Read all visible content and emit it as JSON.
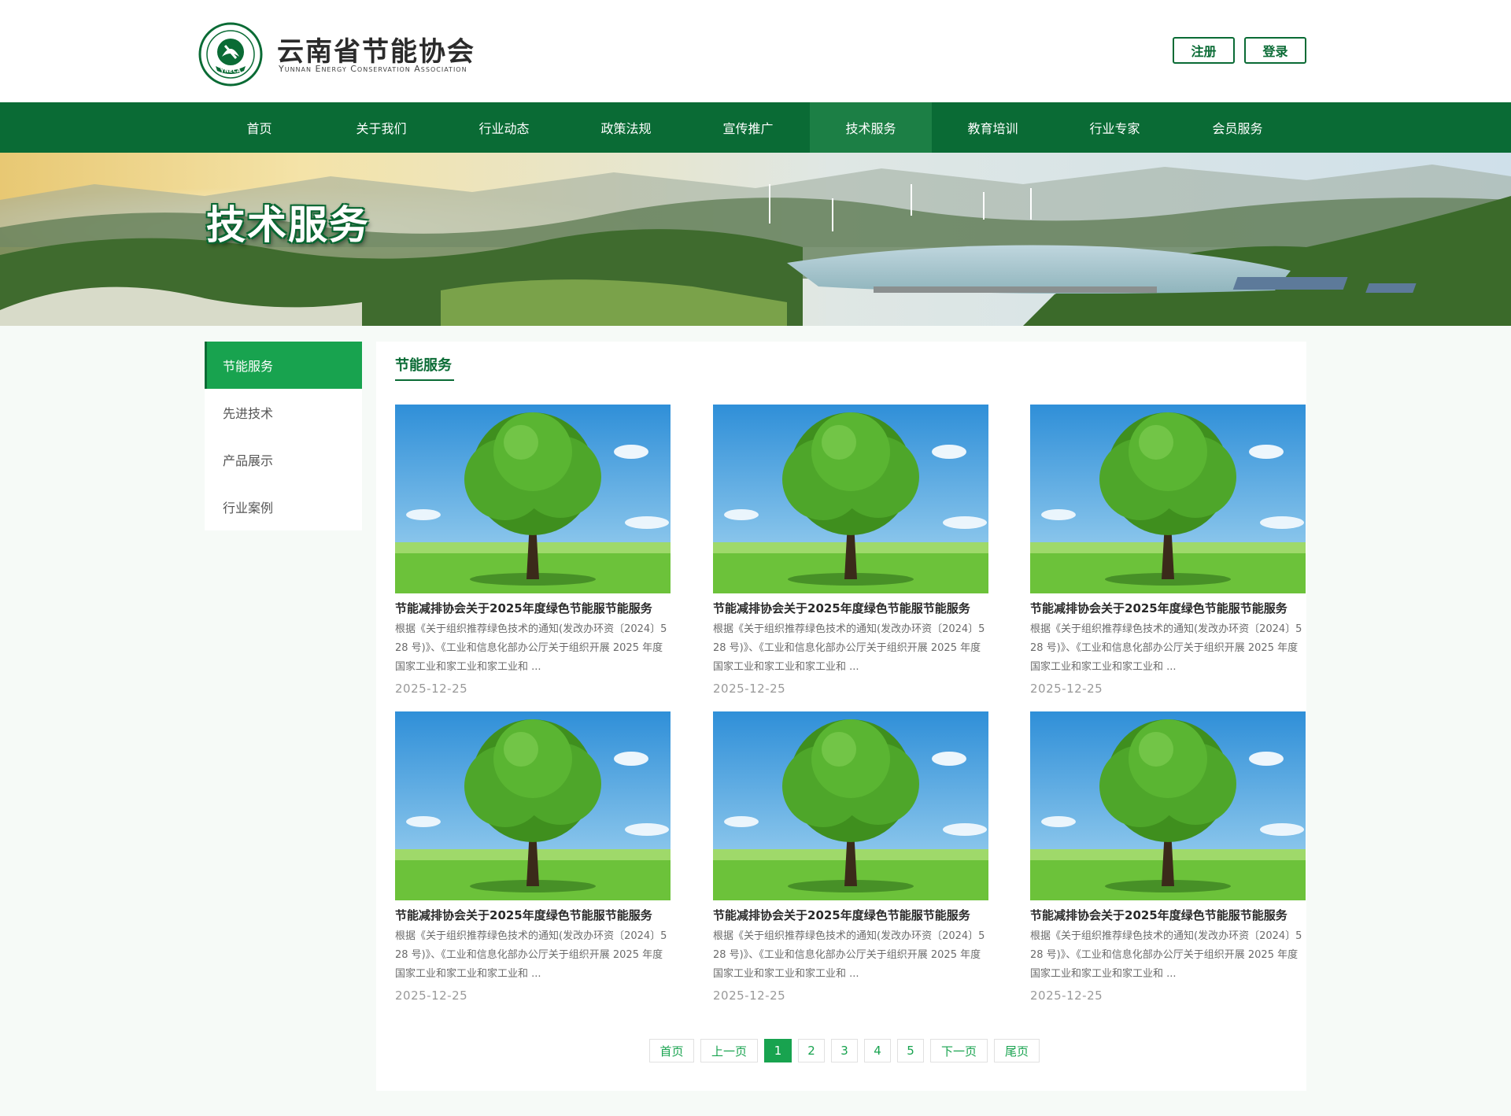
{
  "header": {
    "title": "云南省节能协会",
    "subtitle": "Yunnan Energy Conservation Association",
    "logo_text": "YNECA",
    "register_label": "注册",
    "login_label": "登录"
  },
  "nav": {
    "items": [
      {
        "label": "首页"
      },
      {
        "label": "关于我们"
      },
      {
        "label": "行业动态"
      },
      {
        "label": "政策法规"
      },
      {
        "label": "宣传推广"
      },
      {
        "label": "技术服务"
      },
      {
        "label": "教育培训"
      },
      {
        "label": "行业专家"
      },
      {
        "label": "会员服务"
      }
    ],
    "active": "技术服务"
  },
  "banner": {
    "title": "技术服务"
  },
  "sidebar": {
    "items": [
      {
        "label": "节能服务"
      },
      {
        "label": "先进技术"
      },
      {
        "label": "产品展示"
      },
      {
        "label": "行业案例"
      }
    ],
    "active": "节能服务"
  },
  "content": {
    "title": "节能服务",
    "cards": [
      {
        "title": "节能减排协会关于2025年度绿色节能服节能服务",
        "desc": "根据《关于组织推荐绿色技术的通知(发改办环资〔2024〕528 号)》、《工业和信息化部办公厅关于组织开展 2025 年度国家工业和家工业和家工业和 ...",
        "date": "2025-12-25"
      },
      {
        "title": "节能减排协会关于2025年度绿色节能服节能服务",
        "desc": "根据《关于组织推荐绿色技术的通知(发改办环资〔2024〕528 号)》、《工业和信息化部办公厅关于组织开展 2025 年度国家工业和家工业和家工业和 ...",
        "date": "2025-12-25"
      },
      {
        "title": "节能减排协会关于2025年度绿色节能服节能服务",
        "desc": "根据《关于组织推荐绿色技术的通知(发改办环资〔2024〕528 号)》、《工业和信息化部办公厅关于组织开展 2025 年度国家工业和家工业和家工业和 ...",
        "date": "2025-12-25"
      },
      {
        "title": "节能减排协会关于2025年度绿色节能服节能服务",
        "desc": "根据《关于组织推荐绿色技术的通知(发改办环资〔2024〕528 号)》、《工业和信息化部办公厅关于组织开展 2025 年度国家工业和家工业和家工业和 ...",
        "date": "2025-12-25"
      },
      {
        "title": "节能减排协会关于2025年度绿色节能服节能服务",
        "desc": "根据《关于组织推荐绿色技术的通知(发改办环资〔2024〕528 号)》、《工业和信息化部办公厅关于组织开展 2025 年度国家工业和家工业和家工业和 ...",
        "date": "2025-12-25"
      },
      {
        "title": "节能减排协会关于2025年度绿色节能服节能服务",
        "desc": "根据《关于组织推荐绿色技术的通知(发改办环资〔2024〕528 号)》、《工业和信息化部办公厅关于组织开展 2025 年度国家工业和家工业和家工业和 ...",
        "date": "2025-12-25"
      }
    ]
  },
  "pagination": {
    "first": "首页",
    "prev": "上一页",
    "pages": [
      "1",
      "2",
      "3",
      "4",
      "5"
    ],
    "current": "1",
    "next": "下一页",
    "last": "尾页"
  },
  "colors": {
    "brand_dark": "#0a6b35",
    "brand_bright": "#18a34f",
    "nav_active": "#1c7f45"
  }
}
